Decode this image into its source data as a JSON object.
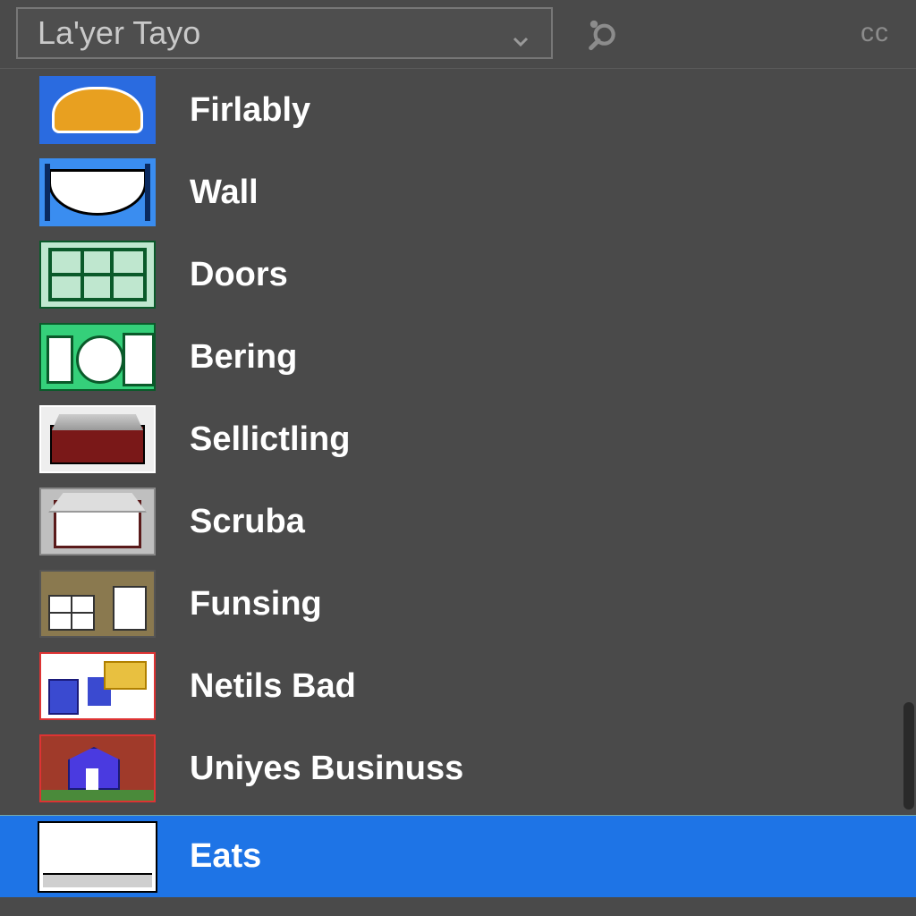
{
  "header": {
    "dropdown_label": "La'yer Tayo",
    "cc_label": "cc"
  },
  "layers": [
    {
      "label": "Firlably",
      "selected": false,
      "thumb": "t0"
    },
    {
      "label": "Wall",
      "selected": false,
      "thumb": "t1"
    },
    {
      "label": "Doors",
      "selected": false,
      "thumb": "t2"
    },
    {
      "label": "Bering",
      "selected": false,
      "thumb": "t3"
    },
    {
      "label": "Sellictling",
      "selected": false,
      "thumb": "t4"
    },
    {
      "label": "Scruba",
      "selected": false,
      "thumb": "t5"
    },
    {
      "label": "Funsing",
      "selected": false,
      "thumb": "t6"
    },
    {
      "label": "Netils Bad",
      "selected": false,
      "thumb": "t7"
    },
    {
      "label": "Uniyes Businuss",
      "selected": false,
      "thumb": "t8"
    },
    {
      "label": "Eats",
      "selected": true,
      "thumb": "t9"
    }
  ]
}
